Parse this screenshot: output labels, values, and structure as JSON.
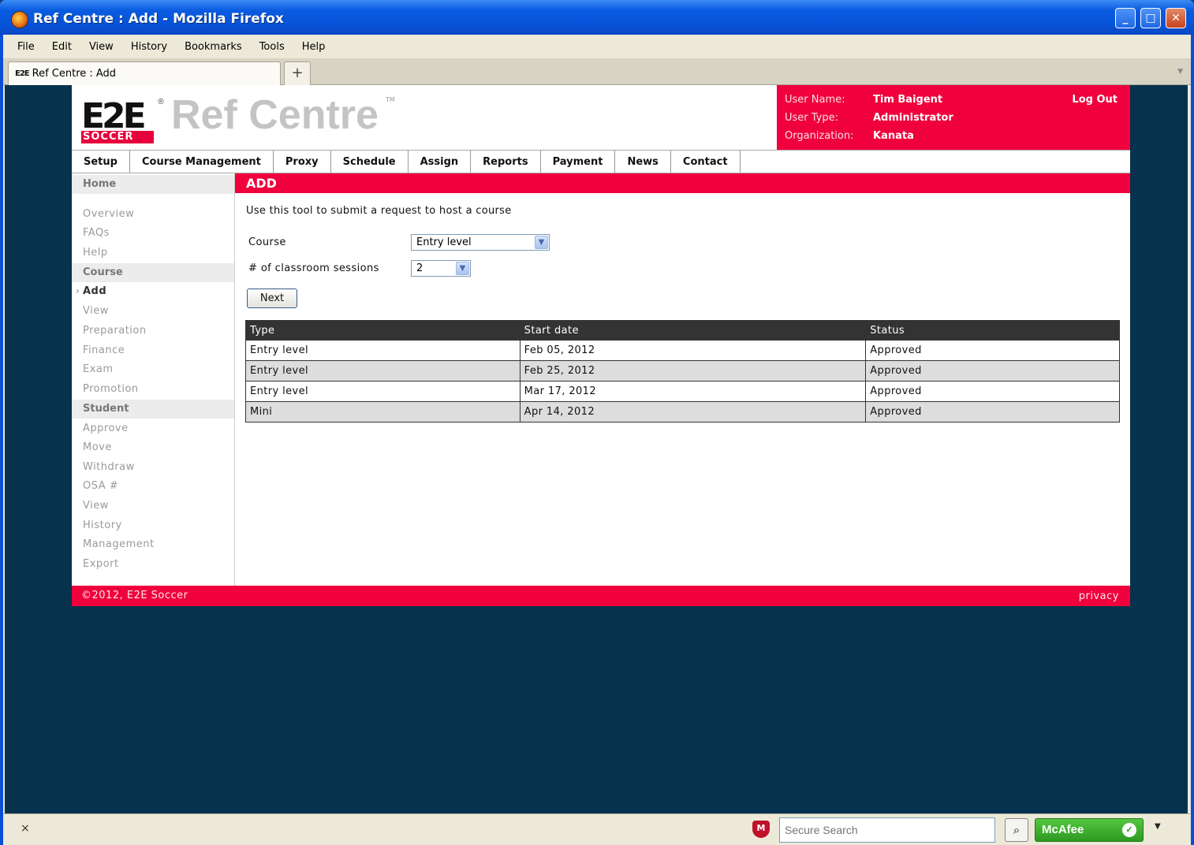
{
  "window": {
    "title": "Ref Centre : Add - Mozilla Firefox",
    "minimize": "_",
    "maximize": "□",
    "close": "✕"
  },
  "menubar": [
    "File",
    "Edit",
    "View",
    "History",
    "Bookmarks",
    "Tools",
    "Help"
  ],
  "tab": {
    "favicon": "E2E",
    "label": "Ref Centre : Add",
    "new_tab": "+"
  },
  "site": {
    "logo_text": "E2E",
    "logo_sub": "SOCCER",
    "title": "Ref Centre",
    "user": {
      "name_label": "User Name:",
      "name": "Tim Baigent",
      "type_label": "User Type:",
      "type": "Administrator",
      "org_label": "Organization:",
      "org": "Kanata",
      "logout": "Log Out"
    },
    "nav": [
      "Setup",
      "Course Management",
      "Proxy",
      "Schedule",
      "Assign",
      "Reports",
      "Payment",
      "News",
      "Contact"
    ]
  },
  "sidebar": {
    "home": "Home",
    "overview": "Overview",
    "faqs": "FAQs",
    "help": "Help",
    "course_head": "Course",
    "add": "Add",
    "view": "View",
    "preparation": "Preparation",
    "finance": "Finance",
    "exam": "Exam",
    "promotion": "Promotion",
    "student_head": "Student",
    "approve": "Approve",
    "move": "Move",
    "withdraw": "Withdraw",
    "osa": "OSA #",
    "view2": "View",
    "history": "History",
    "management": "Management",
    "export": "Export"
  },
  "main": {
    "heading": "ADD",
    "intro": "Use this tool to submit a request to host a course",
    "course_label": "Course",
    "course_value": "Entry level",
    "sessions_label": "# of classroom sessions",
    "sessions_value": "2",
    "next_button": "Next",
    "table": {
      "headers": [
        "Type",
        "Start date",
        "Status"
      ],
      "rows": [
        [
          "Entry level",
          "Feb 05, 2012",
          "Approved"
        ],
        [
          "Entry level",
          "Feb 25, 2012",
          "Approved"
        ],
        [
          "Entry level",
          "Mar 17, 2012",
          "Approved"
        ],
        [
          "Mini",
          "Apr 14, 2012",
          "Approved"
        ]
      ]
    }
  },
  "footer": {
    "copyright": "©2012, E2E Soccer",
    "privacy": "privacy"
  },
  "statusbar": {
    "close": "×",
    "search_placeholder": "Secure Search",
    "mcafee": "McAfee"
  }
}
